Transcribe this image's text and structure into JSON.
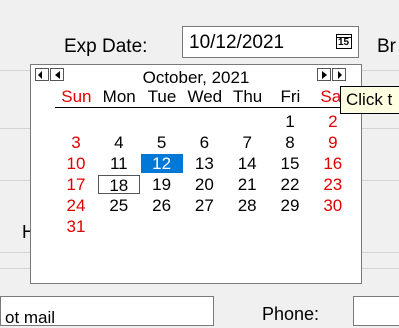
{
  "form": {
    "exp_date_label": "Exp Date:",
    "exp_date_value": "10/12/2021",
    "calendar_button_glyph": "15",
    "next_field_label": "Br",
    "side_label": "H",
    "email_value": "ot mail",
    "phone_label": "Phone:"
  },
  "calendar": {
    "month_title": "October, 2021",
    "weekdays": [
      "Sun",
      "Mon",
      "Tue",
      "Wed",
      "Thu",
      "Fri",
      "Sat"
    ],
    "days": [
      [
        null,
        null,
        null,
        null,
        null,
        "1",
        "2"
      ],
      [
        "3",
        "4",
        "5",
        "6",
        "7",
        "8",
        "9"
      ],
      [
        "10",
        "11",
        "12",
        "13",
        "14",
        "15",
        "16"
      ],
      [
        "17",
        "18",
        "19",
        "20",
        "21",
        "22",
        "23"
      ],
      [
        "24",
        "25",
        "26",
        "27",
        "28",
        "29",
        "30"
      ],
      [
        "31",
        null,
        null,
        null,
        null,
        null,
        null
      ]
    ],
    "selected_day": "12",
    "today_day": "18",
    "weekend_color": "#e00000",
    "selection_color": "#0078d7"
  },
  "tooltip": {
    "text": "Click t"
  }
}
